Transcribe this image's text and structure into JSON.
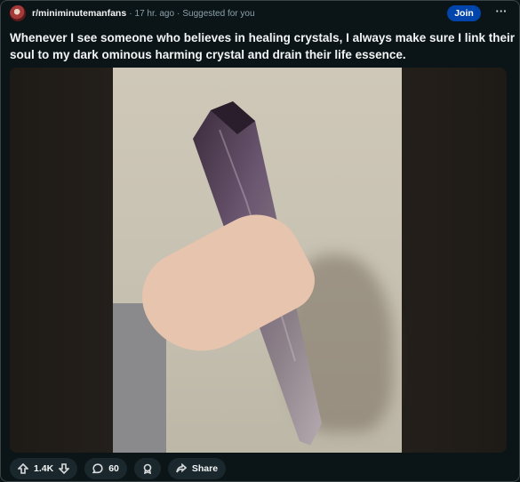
{
  "post": {
    "subreddit": "r/miniminutemanfans",
    "age": "17 hr. ago",
    "suggested": "Suggested for you",
    "join_label": "Join",
    "more_label": "···",
    "title": "Whenever I see someone who believes in healing crystals, I always make sure I link their soul to my dark ominous harming crystal and drain their life essence."
  },
  "actions": {
    "votes": "1.4K",
    "comments": "60",
    "share_label": "Share"
  },
  "icons": [
    "subreddit-avatar",
    "upvote-icon",
    "downvote-icon",
    "comment-icon",
    "award-icon",
    "share-icon",
    "more-icon"
  ]
}
